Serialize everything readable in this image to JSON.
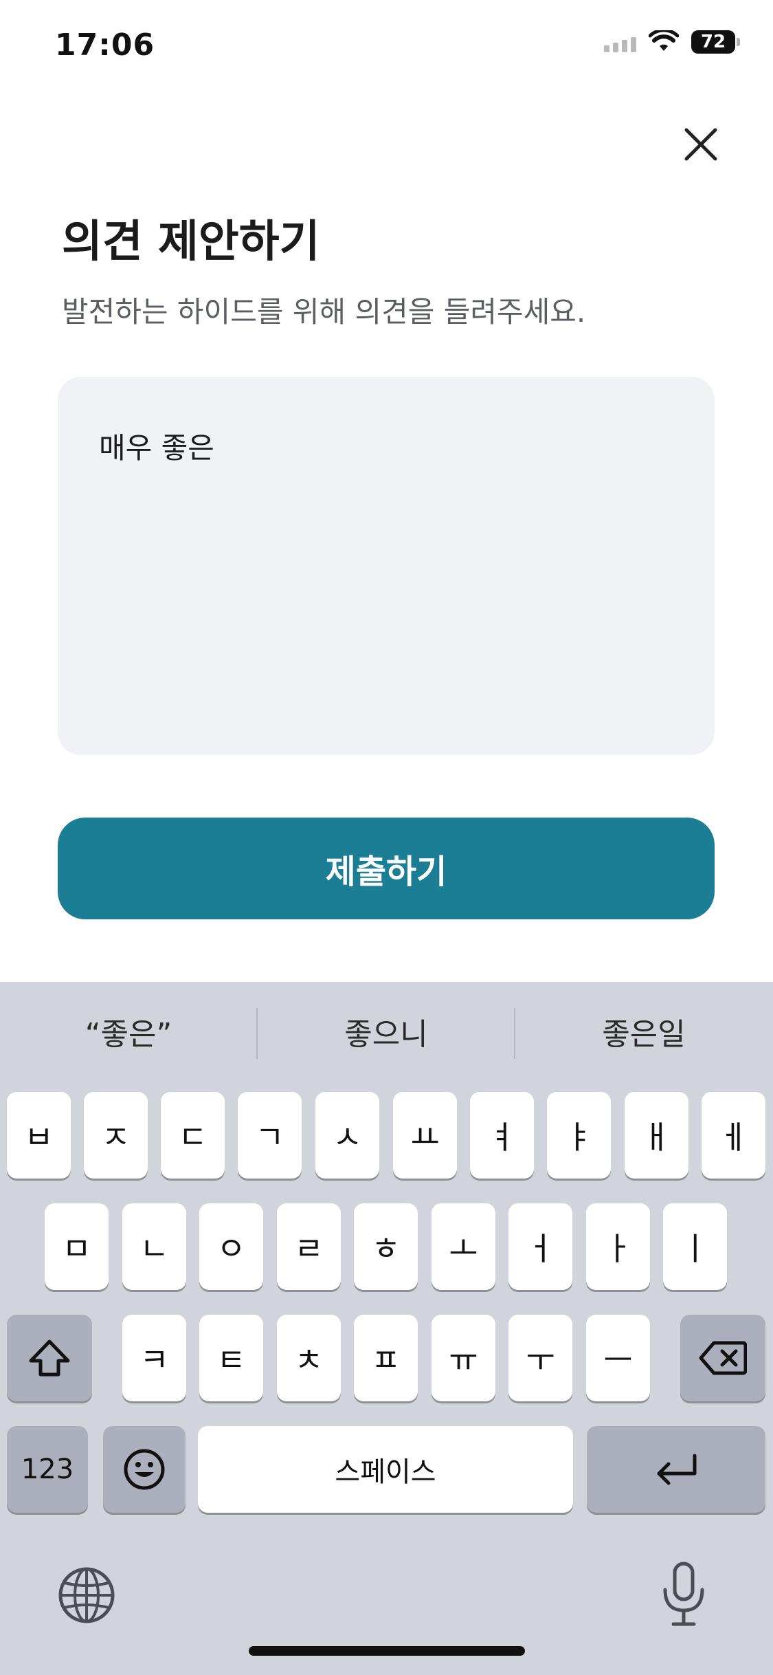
{
  "status": {
    "time": "17:06",
    "battery": "72"
  },
  "header": {
    "title": "의견 제안하기",
    "subtitle": "발전하는 하이드를 위해 의견을 들려주세요."
  },
  "feedback": {
    "value": "매우 좋은"
  },
  "submit": {
    "label": "제출하기"
  },
  "keyboard": {
    "suggestions": [
      "“좋은”",
      "좋으니",
      "좋은일"
    ],
    "row1": [
      "ㅂ",
      "ㅈ",
      "ㄷ",
      "ㄱ",
      "ㅅ",
      "ㅛ",
      "ㅕ",
      "ㅑ",
      "ㅐ",
      "ㅔ"
    ],
    "row2": [
      "ㅁ",
      "ㄴ",
      "ㅇ",
      "ㄹ",
      "ㅎ",
      "ㅗ",
      "ㅓ",
      "ㅏ",
      "ㅣ"
    ],
    "row3": [
      "ㅋ",
      "ㅌ",
      "ㅊ",
      "ㅍ",
      "ㅠ",
      "ㅜ",
      "ㅡ"
    ],
    "numbers_label": "123",
    "space_label": "스페이스",
    "icons": {
      "shift": "shift-icon",
      "backspace": "backspace-icon",
      "emoji": "emoji-icon",
      "return": "return-icon",
      "globe": "globe-icon",
      "mic": "microphone-icon"
    }
  }
}
